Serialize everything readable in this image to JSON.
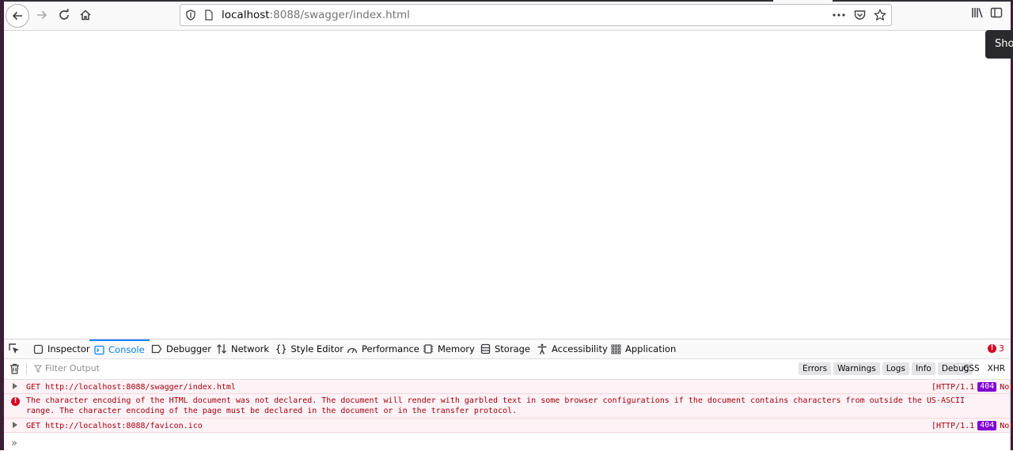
{
  "toolbar": {
    "url_host": "localhost",
    "url_rest": ":8088/swagger/index.html",
    "page_actions_icon": "ellipsis-icon",
    "tooltip_text": "Sho"
  },
  "devtools": {
    "tabs": [
      {
        "label": "Inspector",
        "icon": "inspector-icon"
      },
      {
        "label": "Console",
        "icon": "console-icon",
        "selected": true
      },
      {
        "label": "Debugger",
        "icon": "debugger-icon"
      },
      {
        "label": "Network",
        "icon": "network-icon"
      },
      {
        "label": "Style Editor",
        "icon": "style-editor-icon"
      },
      {
        "label": "Performance",
        "icon": "performance-icon"
      },
      {
        "label": "Memory",
        "icon": "memory-icon"
      },
      {
        "label": "Storage",
        "icon": "storage-icon"
      },
      {
        "label": "Accessibility",
        "icon": "accessibility-icon"
      },
      {
        "label": "Application",
        "icon": "application-icon"
      }
    ],
    "error_count": "3",
    "filter_placeholder": "Filter Output",
    "levels": [
      "Errors",
      "Warnings",
      "Logs",
      "Info",
      "Debug"
    ],
    "types": [
      "CSS",
      "XHR"
    ],
    "messages": [
      {
        "text": "GET http://localhost:8088/swagger/index.html",
        "status_prefix": "[HTTP/1.1",
        "status_code": "404",
        "status_suffix": "Not"
      },
      {
        "text": "The character encoding of the HTML document was not declared. The document will render with garbled text in some browser configurations if the document contains characters from outside the US-ASCII range. The character encoding of the page must be declared in the document or in the transfer protocol."
      },
      {
        "text": "GET http://localhost:8088/favicon.ico",
        "status_prefix": "[HTTP/1.1",
        "status_code": "404",
        "status_suffix": "Not"
      }
    ],
    "prompt_symbol": "»"
  },
  "colors": {
    "accent": "#0a84ff",
    "error": "#d70022",
    "status_badge": "#8000d7",
    "desktop": "#3b1e35"
  }
}
